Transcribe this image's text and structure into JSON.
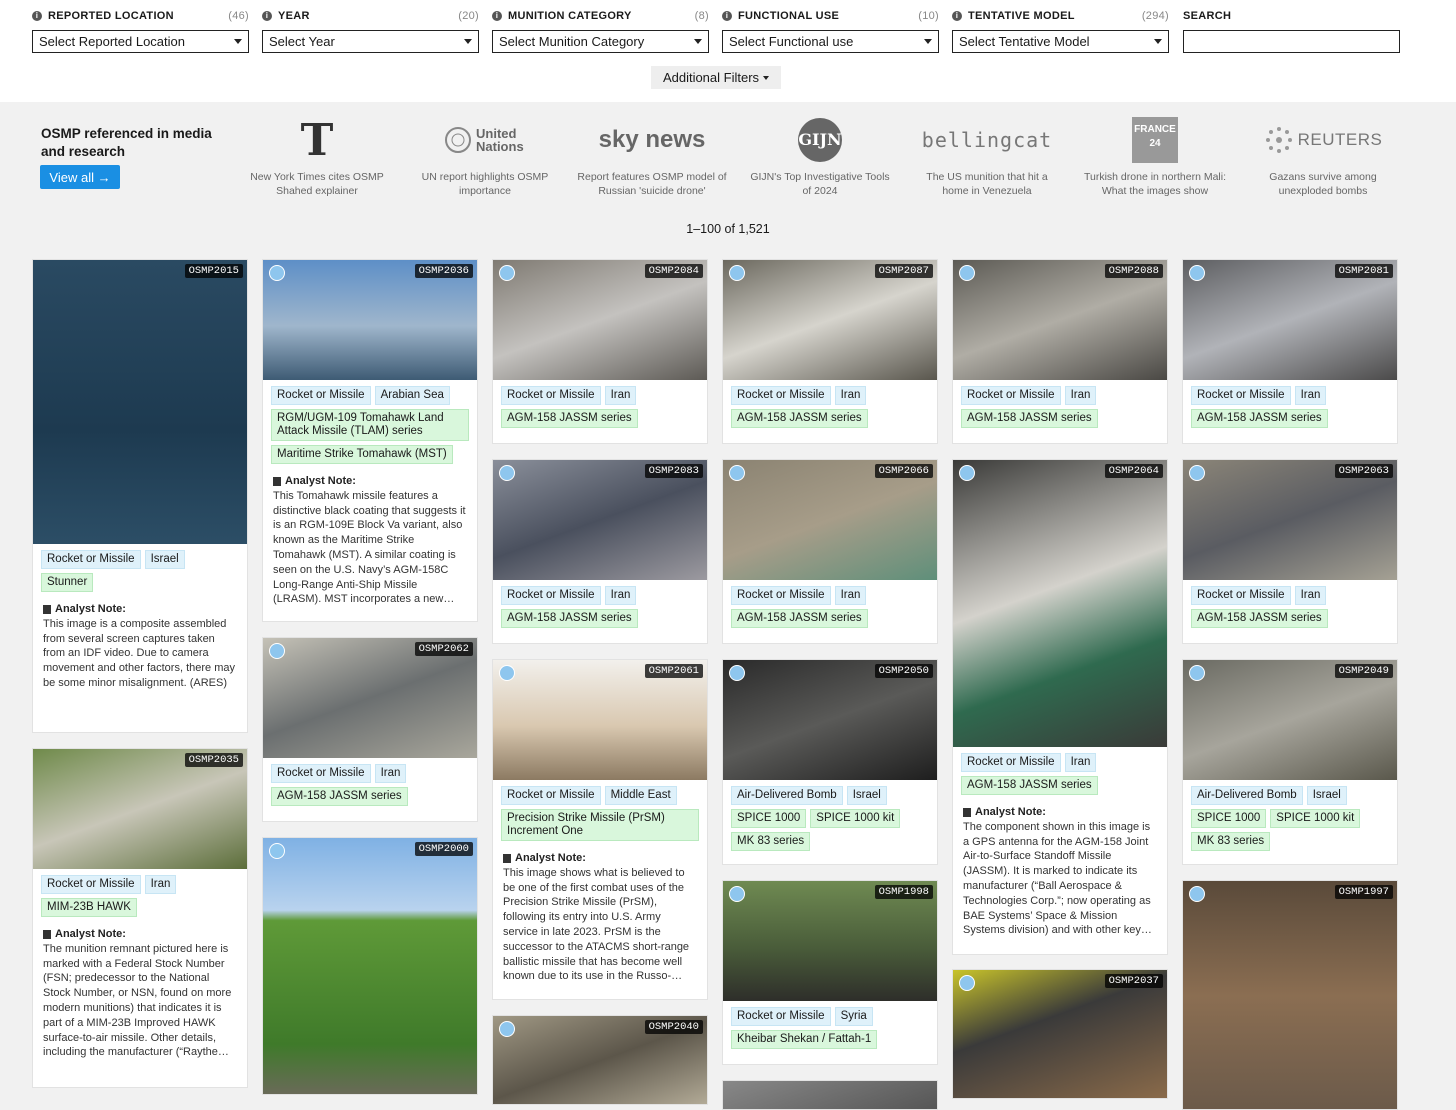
{
  "filters": [
    {
      "label": "REPORTED LOCATION",
      "count": "(46)",
      "value": "Select Reported Location"
    },
    {
      "label": "YEAR",
      "count": "(20)",
      "value": "Select Year"
    },
    {
      "label": "MUNITION CATEGORY",
      "count": "(8)",
      "value": "Select Munition Category"
    },
    {
      "label": "FUNCTIONAL USE",
      "count": "(10)",
      "value": "Select Functional use"
    },
    {
      "label": "TENTATIVE MODEL",
      "count": "(294)",
      "value": "Select Tentative Model"
    }
  ],
  "search": {
    "label": "SEARCH",
    "value": ""
  },
  "additional_filters": "Additional Filters",
  "media": {
    "title": "OSMP referenced in media and research",
    "view_all": "View all →",
    "items": [
      {
        "logo": "T",
        "caption": "New York Times cites OSMP Shahed explainer"
      },
      {
        "logo": "United Nations",
        "caption": "UN report highlights OSMP importance"
      },
      {
        "logo": "sky news",
        "caption": "Report features OSMP model of Russian 'suicide drone'"
      },
      {
        "logo": "GIJN",
        "caption": "GIJN's Top Investigative Tools of 2024"
      },
      {
        "logo": "bellingcat",
        "caption": "The US munition that hit a home in Venezuela"
      },
      {
        "logo": "FRANCE 24",
        "caption": "Turkish drone in northern Mali: What the images show"
      },
      {
        "logo": "REUTERS",
        "caption": "Gazans survive among unexploded bombs"
      }
    ]
  },
  "results": "1–100 of 1,521",
  "colors": {
    "tag_blue": "#dff1fa",
    "tag_green": "#d9f7dc",
    "accent": "#1a8fe3"
  },
  "cards": [
    {
      "id": "OSMP2015",
      "tags": [
        [
          "Rocket or Missile",
          "Israel"
        ],
        [
          "Stunner"
        ]
      ],
      "note": "This image is a composite assembled from several screen captures taken from an IDF video. Due to camera movement and other factors, there may be some minor misalignment. (ARES)"
    },
    {
      "id": "OSMP2035",
      "tags": [
        [
          "Rocket or Missile",
          "Iran"
        ],
        [
          "MIM-23B HAWK"
        ]
      ],
      "note": "The munition remnant pictured here is marked with a Federal Stock Number (FSN; predecessor to the National Stock Number, or NSN, found on more modern munitions) that indicates it is part of a MIM-23B Improved HAWK surface-to-air missile. Other details, including the manufacturer (“Raythe…"
    },
    {
      "id": "OSMP2036",
      "tags": [
        [
          "Rocket or Missile",
          "Arabian Sea"
        ],
        [
          "RGM/UGM-109 Tomahawk Land Attack Missile (TLAM) series"
        ],
        [
          "Maritime Strike Tomahawk (MST)"
        ]
      ],
      "note": "This Tomahawk missile features a distinctive black coating that suggests it is an RGM-109E Block Va variant, also known as the Maritime Strike Tomahawk (MST). A similar coating is seen on the U.S. Navy’s AGM-158C Long-Range Anti-Ship Missile (LRASM). MST incorporates a new…"
    },
    {
      "id": "OSMP2062",
      "tags": [
        [
          "Rocket or Missile",
          "Iran"
        ],
        [
          "AGM-158 JASSM series"
        ]
      ],
      "note": ""
    },
    {
      "id": "OSMP2000",
      "tags": [],
      "note": ""
    },
    {
      "id": "OSMP2084",
      "tags": [
        [
          "Rocket or Missile",
          "Iran"
        ],
        [
          "AGM-158 JASSM series"
        ]
      ],
      "note": ""
    },
    {
      "id": "OSMP2083",
      "tags": [
        [
          "Rocket or Missile",
          "Iran"
        ],
        [
          "AGM-158 JASSM series"
        ]
      ],
      "note": ""
    },
    {
      "id": "OSMP2061",
      "tags": [
        [
          "Rocket or Missile",
          "Middle East"
        ],
        [
          "Precision Strike Missile (PrSM) Increment One"
        ]
      ],
      "note": "This image shows what is believed to be one of the first combat uses of the Precision Strike Missile (PrSM), following its entry into U.S. Army service in late 2023. PrSM is the successor to the ATACMS short-range ballistic missile that has become well known due to its use in the Russo-…"
    },
    {
      "id": "OSMP2040",
      "tags": [],
      "note": ""
    },
    {
      "id": "OSMP2087",
      "tags": [
        [
          "Rocket or Missile",
          "Iran"
        ],
        [
          "AGM-158 JASSM series"
        ]
      ],
      "note": ""
    },
    {
      "id": "OSMP2066",
      "tags": [
        [
          "Rocket or Missile",
          "Iran"
        ],
        [
          "AGM-158 JASSM series"
        ]
      ],
      "note": ""
    },
    {
      "id": "OSMP2050",
      "tags": [
        [
          "Air-Delivered Bomb",
          "Israel"
        ],
        [
          "SPICE 1000",
          "SPICE 1000 kit"
        ],
        [
          "MK 83 series"
        ]
      ],
      "note": ""
    },
    {
      "id": "OSMP1998",
      "tags": [
        [
          "Rocket or Missile",
          "Syria"
        ],
        [
          "Kheibar Shekan / Fattah-1"
        ]
      ],
      "note": ""
    },
    {
      "id": "OSMP2088",
      "tags": [
        [
          "Rocket or Missile",
          "Iran"
        ],
        [
          "AGM-158 JASSM series"
        ]
      ],
      "note": ""
    },
    {
      "id": "OSMP2064",
      "tags": [
        [
          "Rocket or Missile",
          "Iran"
        ],
        [
          "AGM-158 JASSM series"
        ]
      ],
      "note": "The component shown in this image is a GPS antenna for the AGM-158 Joint Air-to-Surface Standoff Missile (JASSM). It is marked to indicate its manufacturer (“Ball Aerospace & Technologies Corp.”; now operating as BAE Systems’ Space & Mission Systems division) and with other key…"
    },
    {
      "id": "OSMP2037",
      "tags": [],
      "note": ""
    },
    {
      "id": "OSMP2081",
      "tags": [
        [
          "Rocket or Missile",
          "Iran"
        ],
        [
          "AGM-158 JASSM series"
        ]
      ],
      "note": ""
    },
    {
      "id": "OSMP2063",
      "tags": [
        [
          "Rocket or Missile",
          "Iran"
        ],
        [
          "AGM-158 JASSM series"
        ]
      ],
      "note": ""
    },
    {
      "id": "OSMP2049",
      "tags": [
        [
          "Air-Delivered Bomb",
          "Israel"
        ],
        [
          "SPICE 1000",
          "SPICE 1000 kit"
        ],
        [
          "MK 83 series"
        ]
      ],
      "note": ""
    },
    {
      "id": "OSMP1997",
      "tags": [],
      "note": ""
    }
  ],
  "analyst_note_label": "Analyst Note:"
}
